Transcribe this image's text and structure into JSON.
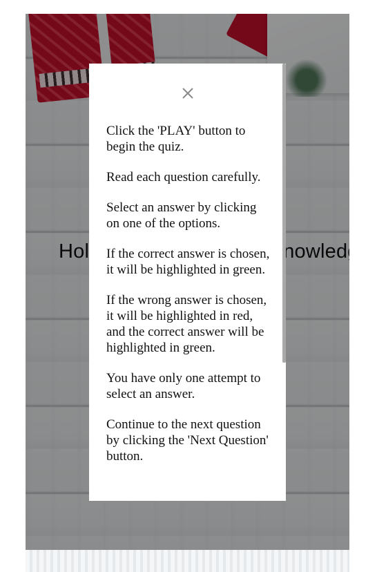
{
  "page": {
    "heading": "Holiday Quiz: Test your knowledge of the"
  },
  "modal": {
    "close_icon": "close-icon",
    "instructions": [
      "Click the 'PLAY' button to begin the quiz.",
      "Read each question carefully.",
      "Select an answer by clicking on one of the options.",
      "If the correct answer is chosen, it will be highlighted in green.",
      "If the wrong answer is chosen, it will be highlighted in red, and the correct answer will be highlighted in green.",
      "You have only one attempt to select an answer.",
      "Continue to the next question by clicking the 'Next Question' button."
    ]
  },
  "colors": {
    "overlay": "#000000",
    "modal_bg": "#ffffff",
    "accent_red": "#c8102e"
  }
}
